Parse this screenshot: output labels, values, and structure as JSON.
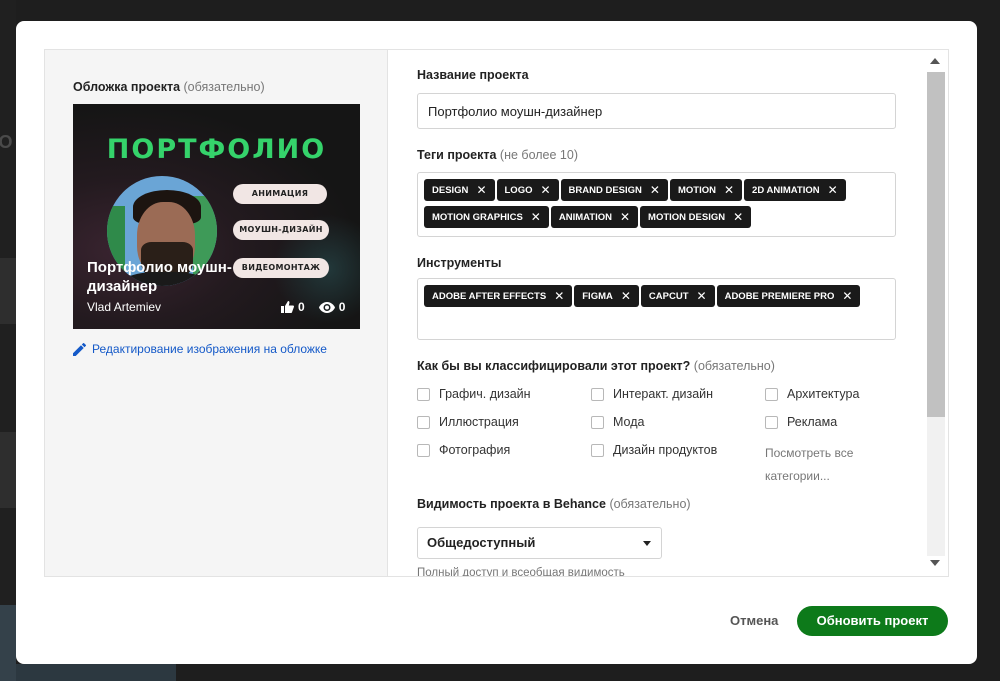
{
  "backdrop": {
    "partial_text": "ТО"
  },
  "cover": {
    "label": "Обложка проекта",
    "label_note": "(обязательно)",
    "headline": "ПОРТФОЛИО",
    "pills": [
      "АНИМАЦИЯ",
      "МОУШН-ДИЗАЙН",
      "ВИДЕОМОНТАЖ"
    ],
    "project_title": "Портфолио моушн-дизайнер",
    "author": "Vlad Artemiev",
    "likes": "0",
    "views": "0",
    "edit_link": "Редактирование изображения на обложке"
  },
  "form": {
    "title_label": "Название проекта",
    "title_value": "Портфолио моушн-дизайнер",
    "tags_label": "Теги проекта",
    "tags_note": "(не более 10)",
    "tags": [
      "DESIGN",
      "LOGO",
      "BRAND DESIGN",
      "MOTION",
      "2D ANIMATION",
      "MOTION GRAPHICS",
      "ANIMATION",
      "MOTION DESIGN"
    ],
    "tools_label": "Инструменты",
    "tools": [
      "ADOBE AFTER EFFECTS",
      "FIGMA",
      "CAPCUT",
      "ADOBE PREMIERE PRO"
    ],
    "classify_label": "Как бы вы классифицировали этот проект?",
    "classify_note": "(обязательно)",
    "categories": [
      "Графич. дизайн",
      "Интеракт. дизайн",
      "Архитектура",
      "Иллюстрация",
      "Мода",
      "Реклама",
      "Фотография",
      "Дизайн продуктов"
    ],
    "see_all": "Посмотреть все категории...",
    "visibility_label": "Видимость проекта в Behance",
    "visibility_note": "(обязательно)",
    "visibility_value": "Общедоступный",
    "visibility_hint": "Полный доступ и всеобщая видимость"
  },
  "footer": {
    "cancel": "Отмена",
    "submit": "Обновить проект"
  },
  "colors": {
    "accent": "#0d7a1a",
    "link": "#1459c8",
    "cover_headline": "#35d36b",
    "tag_bg": "#1a1a1a"
  }
}
